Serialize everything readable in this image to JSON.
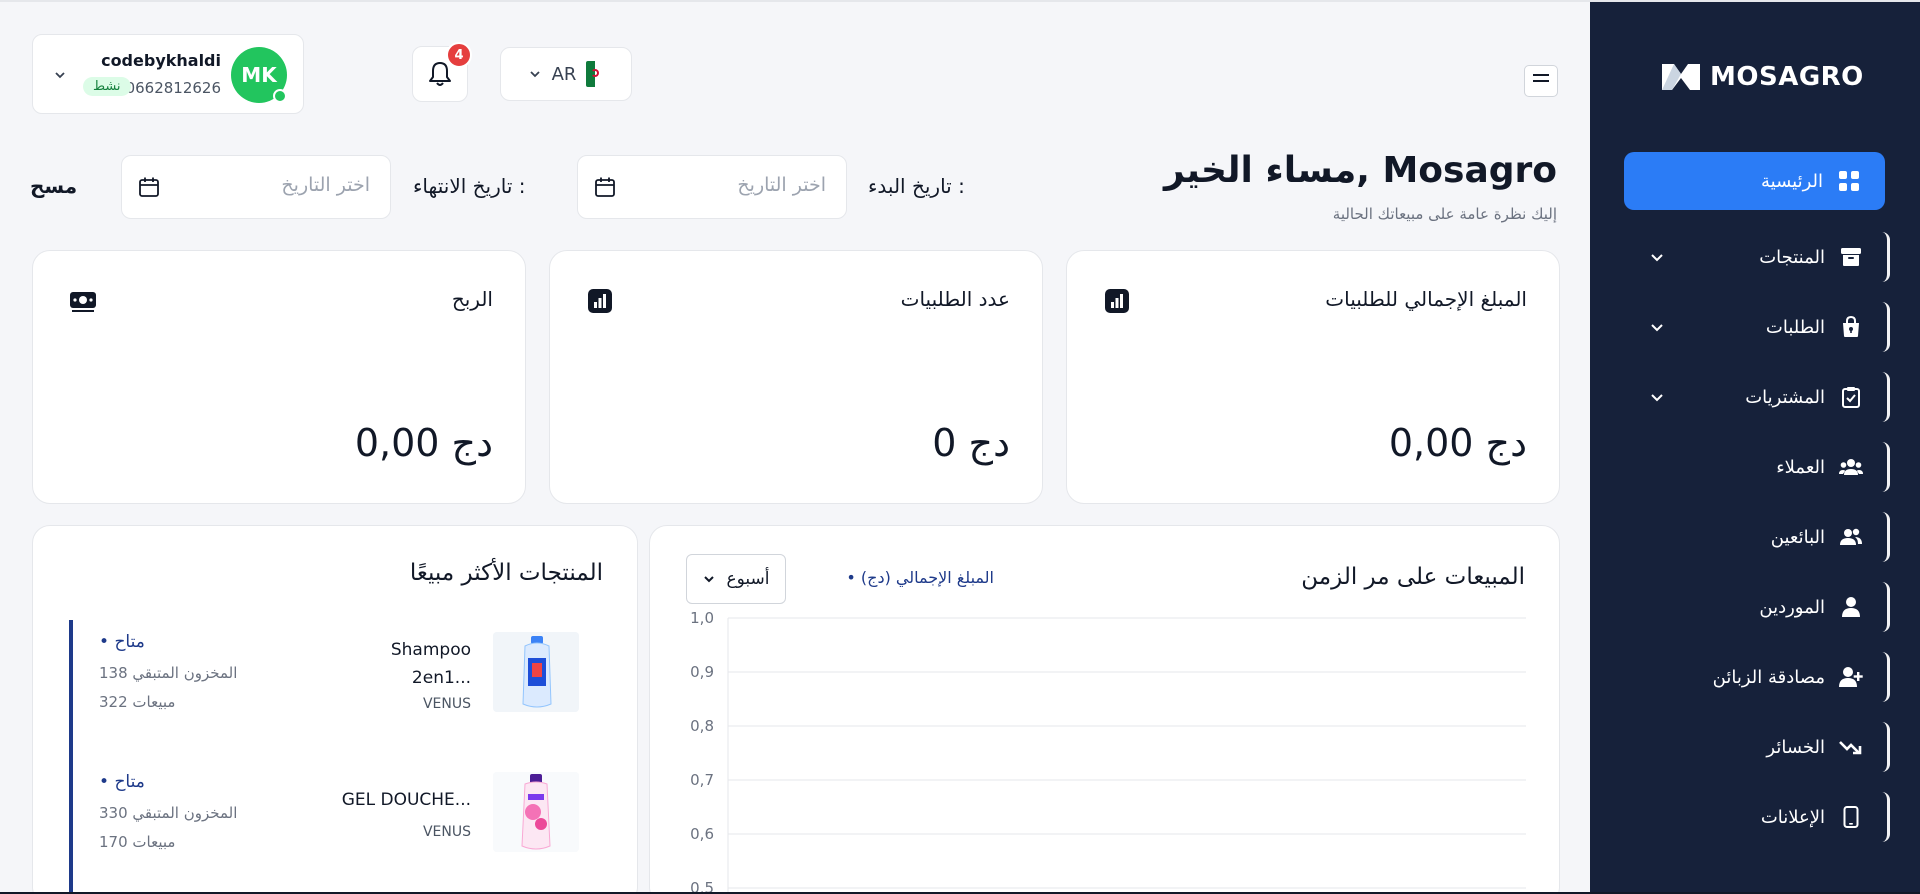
{
  "sidebar": {
    "logo_text": "MOSAGRO",
    "items": [
      {
        "label": "الرئيسية",
        "icon": "grid-icon",
        "active": true
      },
      {
        "label": "المنتجات",
        "icon": "archive-icon",
        "expandable": true
      },
      {
        "label": "الطلبات",
        "icon": "bag-lock-icon",
        "expandable": true
      },
      {
        "label": "المشتريات",
        "icon": "clipboard-check-icon",
        "expandable": true
      },
      {
        "label": "العملاء",
        "icon": "users-group-icon"
      },
      {
        "label": "البائعين",
        "icon": "users-icon"
      },
      {
        "label": "الموردين",
        "icon": "user-icon"
      },
      {
        "label": "مصادقة الزبائن",
        "icon": "user-plus-icon"
      },
      {
        "label": "الخسائر",
        "icon": "trend-down-icon"
      },
      {
        "label": "الإعلانات",
        "icon": "mobile-icon"
      }
    ]
  },
  "header": {
    "language": "AR",
    "notifications_count": "4",
    "user": {
      "name": "codebykhaldi",
      "phone": "0662812626",
      "status": "نشط",
      "initials": "MK"
    }
  },
  "greeting": {
    "title": "مساء الخير, Mosagro",
    "subtitle": "إليك نظرة عامة على مبيعاتك الحالية"
  },
  "filters": {
    "start_label": "تاريخ البدء :",
    "end_label": "تاريخ الانتهاء :",
    "start_placeholder": "اختر التاريخ",
    "end_placeholder": "اختر التاريخ",
    "clear_label": "مسح"
  },
  "kpis": [
    {
      "title": "المبلغ الإجمالي للطلبيات",
      "value": "0,00 دج",
      "icon": "chart-bars-icon"
    },
    {
      "title": "عدد الطلبيات",
      "value": "0 دج",
      "icon": "chart-bars-icon"
    },
    {
      "title": "الربح",
      "value": "0,00 دج",
      "icon": "money-icon"
    }
  ],
  "sales_chart": {
    "title": "المبيعات على مر الزمن",
    "legend": "• المبلغ الإجمالي (دج)",
    "period": "أسبوع"
  },
  "chart_data": {
    "type": "line",
    "title": "المبيعات على مر الزمن",
    "series": [
      {
        "name": "المبلغ الإجمالي (دج)",
        "values": []
      }
    ],
    "ytick_labels": [
      "1,0",
      "0,9",
      "0,8",
      "0,7",
      "0,6",
      "0,5"
    ],
    "ylim": [
      0.5,
      1.0
    ],
    "grid": true
  },
  "top_products": {
    "title": "المنتجات الأكثر مبيعًا",
    "items": [
      {
        "name": "Shampoo 2en1...",
        "brand": "VENUS",
        "status": "• متاح",
        "stock": "138 المخزون المتبقي",
        "sales": "322 مبيعات"
      },
      {
        "name": "GEL DOUCHE...",
        "brand": "VENUS",
        "status": "• متاح",
        "stock": "330 المخزون المتبقي",
        "sales": "170 مبيعات"
      }
    ]
  },
  "colors": {
    "sidebar_bg": "#16213a",
    "accent": "#2b7cf6",
    "success": "#22c55e",
    "danger": "#e53e3e",
    "link": "#1e3a8a"
  }
}
